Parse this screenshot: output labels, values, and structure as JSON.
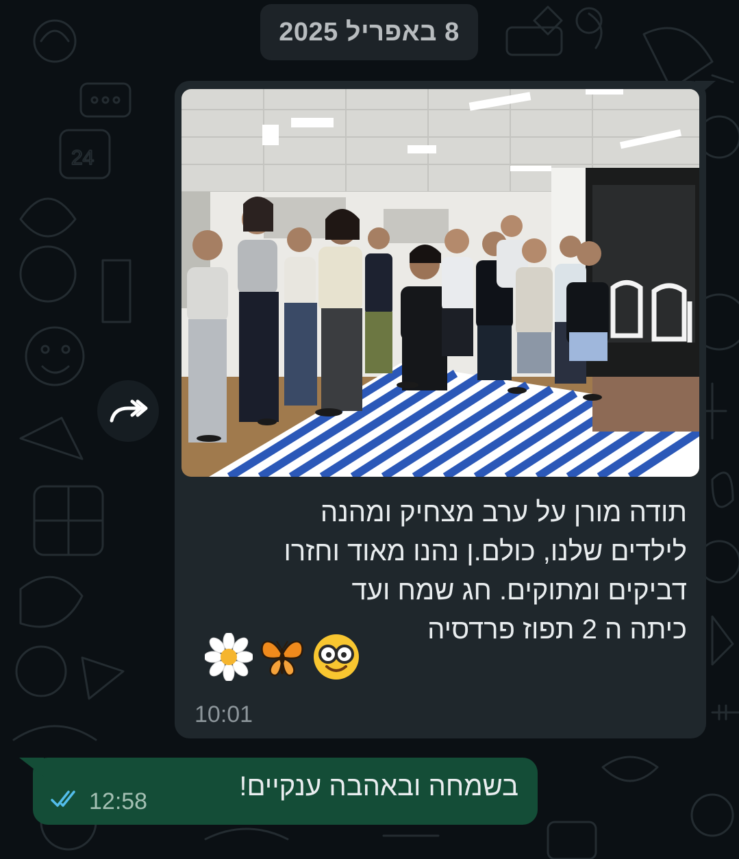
{
  "date_chip": "8 באפריל 2025",
  "incoming_message": {
    "caption_lines": [
      "תודה מורן על ערב מצחיק ומהנה",
      "לילדים שלנו, כולם.ן נהנו מאוד וחזרו",
      "דביקים ומתוקים. חג שמח ועד",
      "כיתה ה 2 תפוז פרדסיה"
    ],
    "emojis": [
      "smiling-face-with-glasses-emoji",
      "butterfly-emoji",
      "daisy-emoji"
    ],
    "time": "10:01"
  },
  "outgoing_message": {
    "text": "בשמחה ובאהבה ענקיים!",
    "time": "12:58",
    "status": "read",
    "tick_color": "#53bdeb"
  },
  "colors": {
    "background": "#0b1014",
    "incoming_bubble": "#1f272c",
    "outgoing_bubble": "#144d37",
    "date_chip": "#1d2328"
  }
}
